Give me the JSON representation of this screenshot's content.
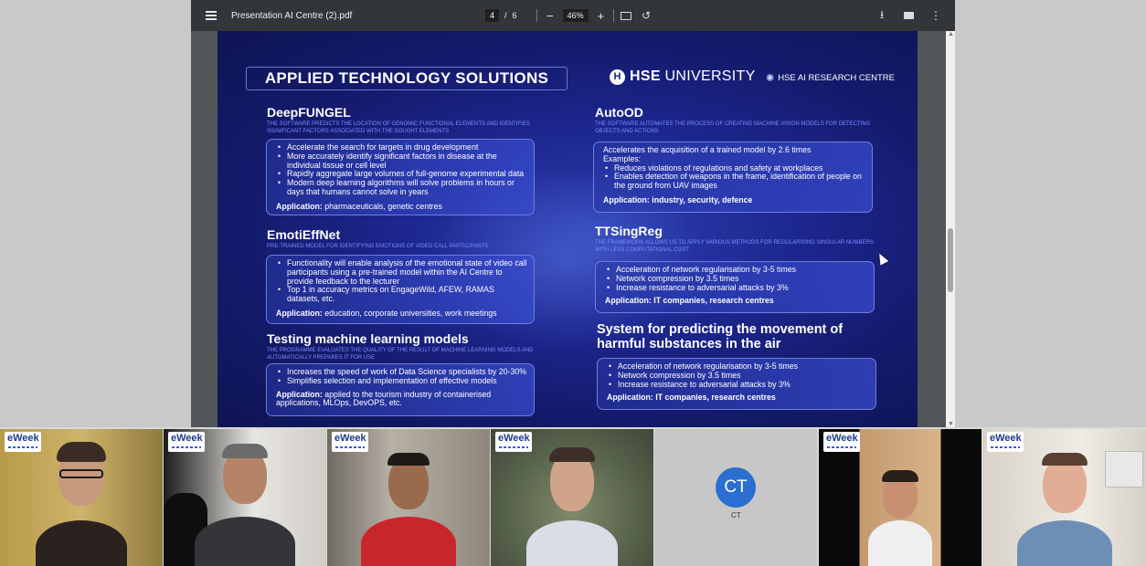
{
  "viewer": {
    "doc_title": "Presentation AI Centre (2).pdf",
    "page_current": "4",
    "page_sep": "/",
    "page_total": "6",
    "zoom_minus": "−",
    "zoom_value": "46%",
    "zoom_plus": "+",
    "icons": [
      "menu-icon",
      "fit-page-icon",
      "rotate-icon",
      "download-icon",
      "print-icon",
      "more-icon"
    ]
  },
  "slide": {
    "title": "APPLIED TECHNOLOGY SOLUTIONS",
    "logo_hse_mark": "H",
    "logo_hse_bold": "HSE",
    "logo_hse_rest": " UNIVERSITY",
    "logo_ai": "HSE AI RESEARCH CENTRE",
    "sections": [
      {
        "title": "DeepFUNGEL",
        "subtitle": "THE SOFTWARE PREDICTS THE LOCATION OF GENOMIC FUNCTIONAL ELEMENTS AND IDENTIFIES SIGNIFICANT FACTORS ASSOCIATED WITH THE SOUGHT ELEMENTS",
        "bullets": [
          "Accelerate the search for targets in drug development",
          "More accurately identify significant factors in disease at the individual tissue or cell level",
          "Rapidly aggregate large volumes of full-genome experimental data",
          "Modern deep learning algorithms will solve problems in hours or days that humans cannot solve in years"
        ],
        "app_label": "Application:",
        "app_text": " pharmaceuticals, genetic centres"
      },
      {
        "title": "EmotiEffNet",
        "subtitle": "PRE-TRAINED MODEL FOR IDENTIFYING EMOTIONS OF VIDEO CALL PARTICIPANTS",
        "bullets": [
          "Functionality will enable analysis of the emotional state of video call participants using a pre-trained model within the AI Centre to provide feedback to the lecturer",
          "Top 1 in accuracy metrics on EngageWild, AFEW, RAMAS datasets, etc."
        ],
        "app_label": "Application:",
        "app_text": " education, corporate universities, work meetings"
      },
      {
        "title": "Testing machine learning models",
        "subtitle": "THE PROGRAMME EVALUATES THE QUALITY OF THE RESULT OF MACHINE LEARNING MODELS AND AUTOMATICALLY PREPARES IT FOR USE",
        "bullets": [
          "Increases the speed of work of Data Science specialists by 20-30%",
          "Simplifies selection and implementation of  effective models"
        ],
        "app_label": "Application:",
        "app_text": " applied to the tourism industry of containerised applications, MLOps, DevOPS, etc."
      },
      {
        "title": "AutoOD",
        "subtitle": "THE SOFTWARE AUTOMATES THE PROCESS OF CREATING MACHINE VISION MODELS FOR DETECTING OBJECTS AND ACTIONS",
        "intro1": "Accelerates the acquisition of a trained model by 2.6 times",
        "intro2": "Examples:",
        "bullets": [
          "Reduces violations of regulations and safety at workplaces",
          "Enables detection of weapons in the frame, identification of people on the ground from UAV images"
        ],
        "app_line": "Application: industry, security, defence"
      },
      {
        "title": "TTSingReg",
        "subtitle": "THE FRAMEWORK ALLOWS US TO APPLY VARIOUS METHODS FOR REGULARISING SINGULAR NUMBERS WITH LESS COMPUTATIONAL COST",
        "bullets": [
          "Acceleration of network regularisation by 3-5 times",
          "Network compression by 3.5 times",
          "Increase resistance to adversarial attacks by 3%"
        ],
        "app_line": "Application: IT companies, research centres"
      },
      {
        "title_line1": "System for predicting the movement of",
        "title_line2": "harmful substances in the air",
        "bullets": [
          "Acceleration of network regularisation by 3-5 times",
          "Network compression by 3.5 times",
          "Increase resistance to adversarial attacks by 3%"
        ],
        "app_line": "Application: IT companies, research centres"
      }
    ]
  },
  "participants": {
    "badge_text": "eWeek",
    "ct_initials": "CT",
    "ct_name": "CT"
  }
}
